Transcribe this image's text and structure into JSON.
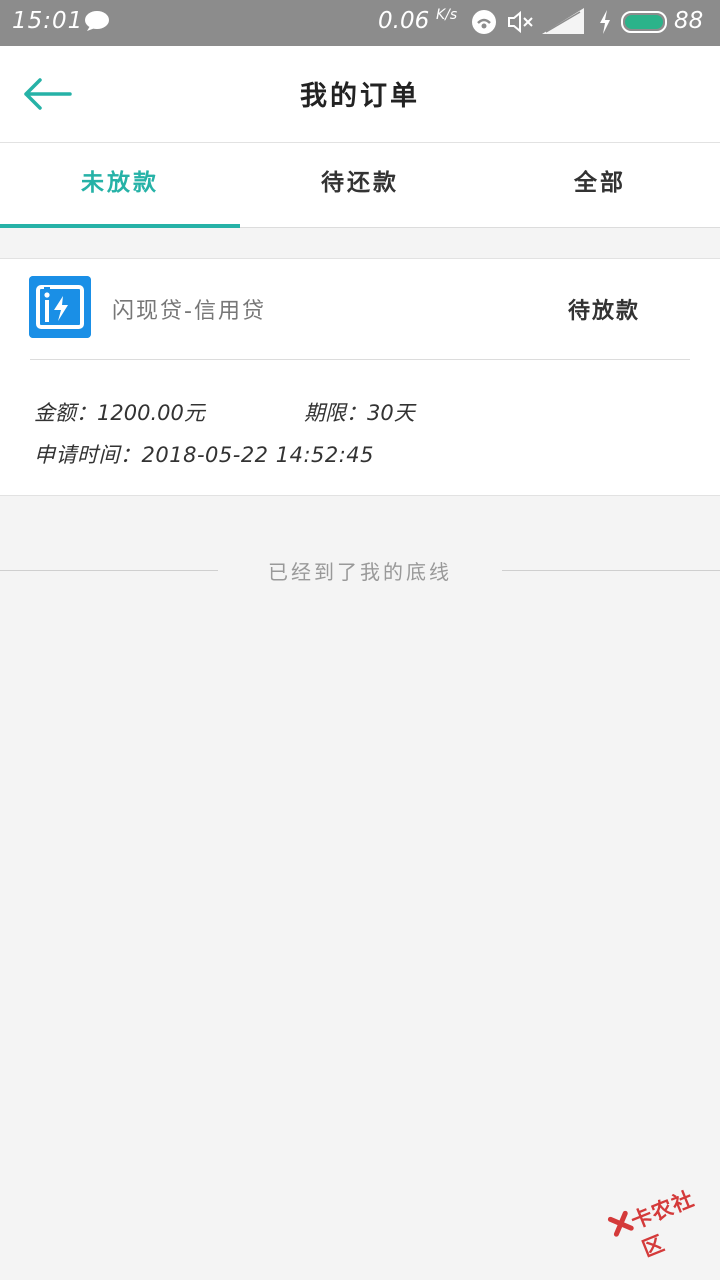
{
  "status_bar": {
    "time": "15:01",
    "net_speed": "0.06",
    "net_speed_unit": "K/s",
    "battery": "88",
    "icons": [
      "chat-icon",
      "wifi-icon",
      "mute-icon",
      "signal-icon",
      "charging-icon",
      "battery-icon"
    ],
    "battery_color": "#2bb38a"
  },
  "header": {
    "title": "我的订单",
    "back_icon": "arrow-left-icon"
  },
  "tabs": [
    {
      "label": "未放款",
      "active": true
    },
    {
      "label": "待还款",
      "active": false
    },
    {
      "label": "全部",
      "active": false
    }
  ],
  "order": {
    "logo_icon": "flash-loan-logo-icon",
    "product_name": "闪现贷-信用贷",
    "status": "待放款",
    "amount_text": "金额：1200.00元",
    "term_text": "期限：30天",
    "apply_time_text": "申请时间：2018-05-22 14:52:45"
  },
  "list_end_text": "已经到了我的底线",
  "watermark_text": "卡农社区",
  "colors": {
    "accent": "#26b2a7",
    "logo_blue": "#1a8fe6",
    "status_bar": "#8c8c8c",
    "background": "#f4f4f4"
  }
}
